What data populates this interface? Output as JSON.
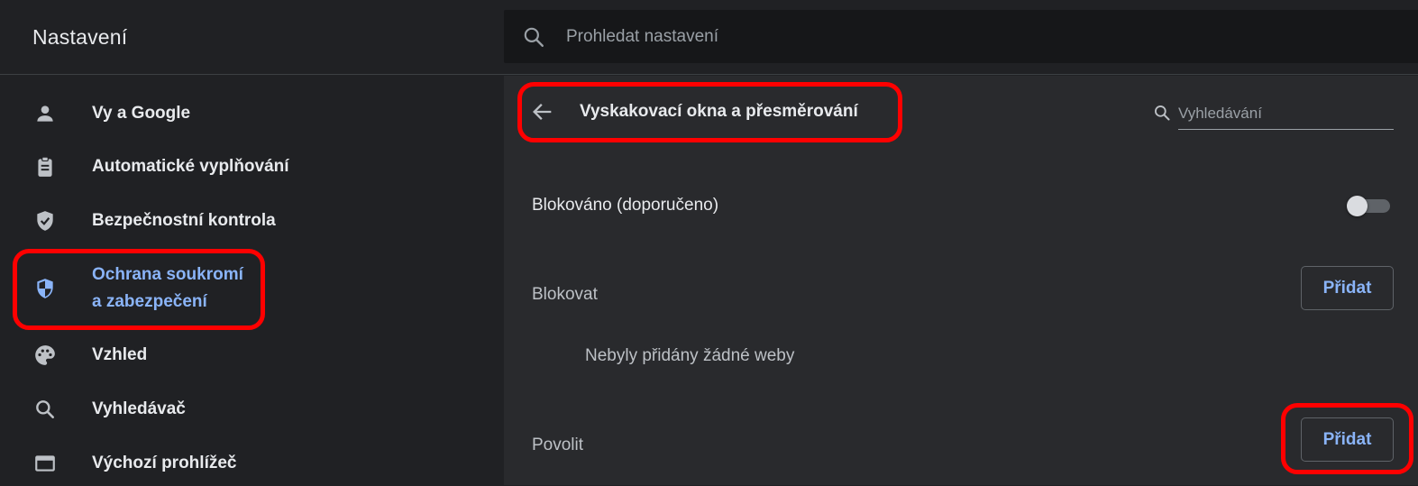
{
  "header": {
    "title": "Nastavení",
    "search_placeholder": "Prohledat nastavení"
  },
  "sidebar": {
    "items": [
      {
        "label": "Vy a Google",
        "icon": "person-icon"
      },
      {
        "label": "Automatické vyplňování",
        "icon": "clipboard-icon"
      },
      {
        "label": "Bezpečnostní kontrola",
        "icon": "shield-check-icon"
      },
      {
        "label_line1": "Ochrana soukromí",
        "label_line2": "a zabezpečení",
        "icon": "privacy-shield-icon",
        "active": true
      },
      {
        "label": "Vzhled",
        "icon": "palette-icon"
      },
      {
        "label": "Vyhledávač",
        "icon": "search-icon"
      },
      {
        "label": "Výchozí prohlížeč",
        "icon": "browser-window-icon"
      }
    ]
  },
  "subpage": {
    "title": "Vyskakovací okna a přesměrování",
    "search_placeholder": "Vyhledávání",
    "blocked_setting": {
      "label": "Blokováno (doporučeno)",
      "enabled": false
    },
    "block_section": {
      "label": "Blokovat",
      "button": "Přidat",
      "empty_text": "Nebyly přidány žádné weby"
    },
    "allow_section": {
      "label": "Povolit",
      "button": "Přidat"
    }
  },
  "colors": {
    "background": "#202124",
    "content_bg": "#292a2d",
    "accent": "#8ab4f8",
    "highlight": "#ff0000"
  }
}
